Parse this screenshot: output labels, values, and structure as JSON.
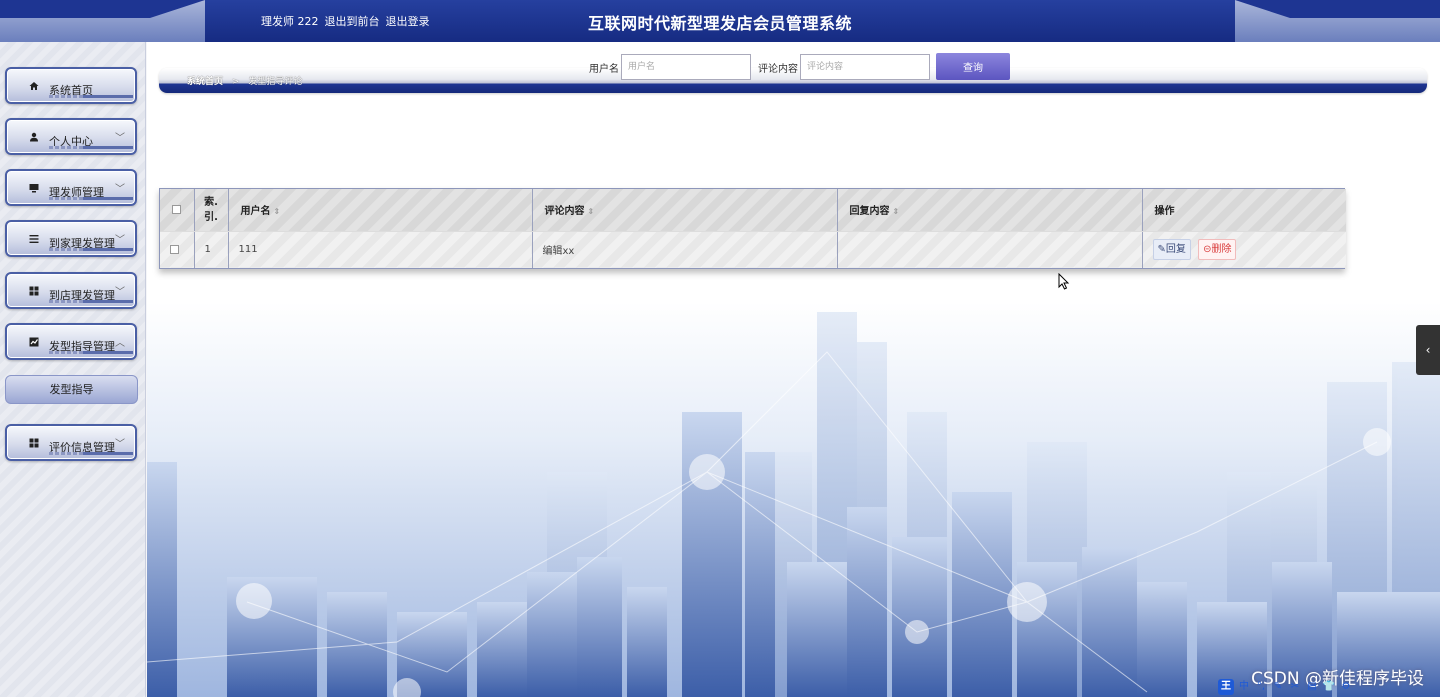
{
  "header": {
    "user_label": "理发师 222",
    "back_to_front": "退出到前台",
    "logout": "退出登录",
    "system_title": "互联网时代新型理发店会员管理系统"
  },
  "sidebar": {
    "items": [
      {
        "label": "系统首页",
        "icon": "home-icon"
      },
      {
        "label": "个人中心",
        "icon": "user-icon"
      },
      {
        "label": "理发师管理",
        "icon": "monitor-icon"
      },
      {
        "label": "到家理发管理",
        "icon": "list-icon"
      },
      {
        "label": "到店理发管理",
        "icon": "grid-icon"
      },
      {
        "label": "发型指导管理",
        "icon": "chart-icon"
      },
      {
        "label": "评价信息管理",
        "icon": "grid-icon"
      }
    ],
    "sub_item": "发型指导"
  },
  "breadcrumb": {
    "home": "系统首页",
    "separator": ">",
    "current": "发型指导评论"
  },
  "search": {
    "username_label": "用户名",
    "username_placeholder": "用户名",
    "comment_label": "评论内容",
    "comment_placeholder": "评论内容",
    "query_button": "查询"
  },
  "table": {
    "columns": {
      "index": "索引",
      "index_line1": "索.",
      "index_line2": "引.",
      "username": "用户名",
      "comment": "评论内容",
      "reply": "回复内容",
      "actions": "操作"
    },
    "rows": [
      {
        "index": "1",
        "username": "111",
        "comment": "编辑xx",
        "reply": ""
      }
    ],
    "reply_button": "回复",
    "delete_button": "删除"
  },
  "watermark": "CSDN @新佳程序毕设",
  "ime_toolbar": [
    "王",
    "中",
    "°,",
    "✎",
    "✂",
    "▤",
    "👕",
    "⚙"
  ],
  "colors": {
    "header_blue": "#1e3592",
    "query_button": "#6b63cc",
    "delete_red": "#d93a3a"
  }
}
